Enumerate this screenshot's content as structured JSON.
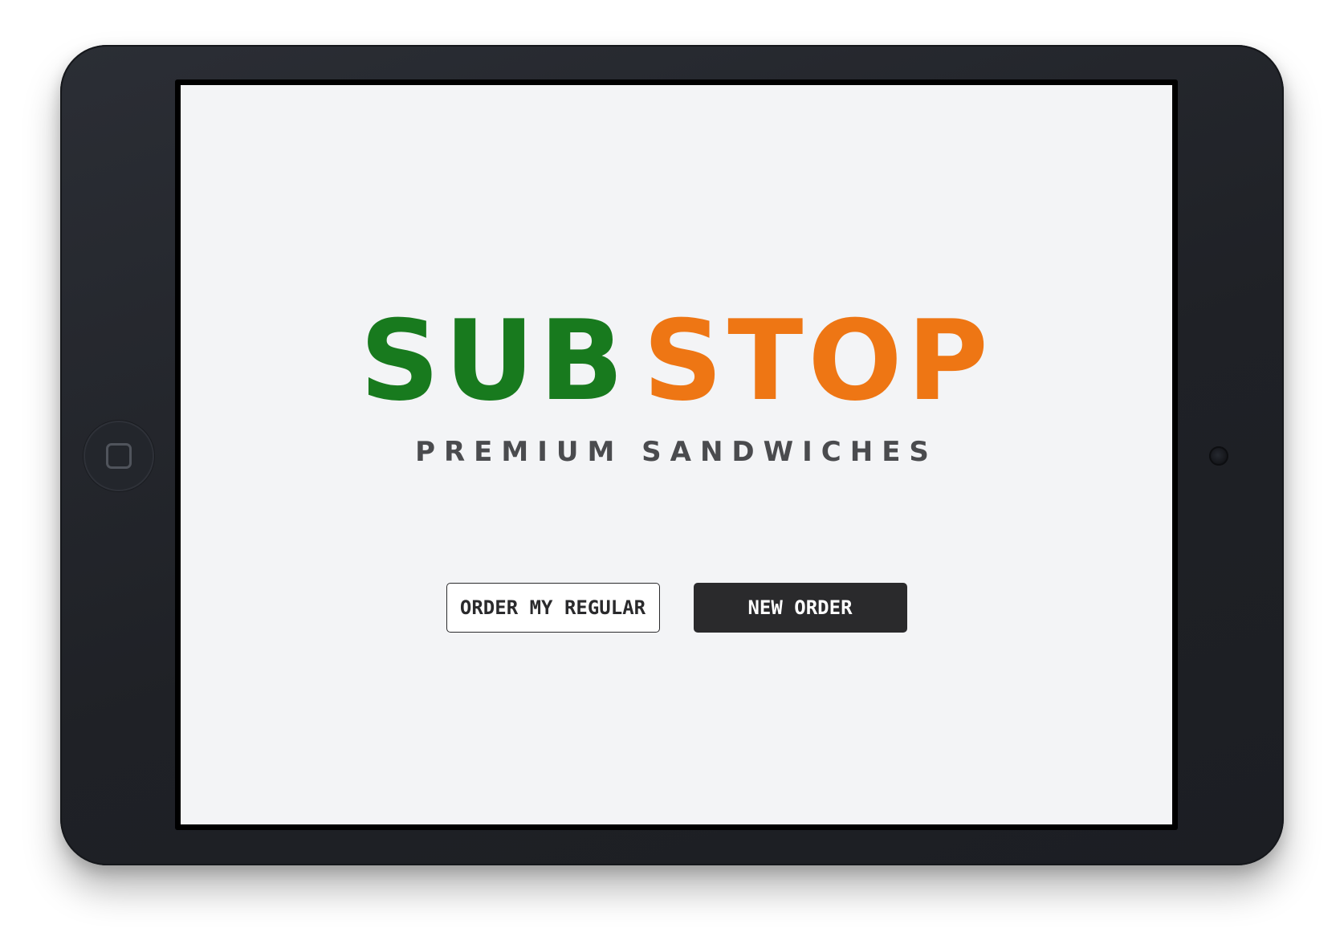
{
  "brand": {
    "name_part1": "SUB",
    "name_part2": "STOP",
    "tagline": "PREMIUM SANDWICHES",
    "color_part1": "#187a1e",
    "color_part2": "#ee7614"
  },
  "actions": {
    "order_regular_label": "ORDER MY REGULAR",
    "new_order_label": "NEW ORDER"
  },
  "device": {
    "home_button_icon": "home-square-icon",
    "camera_icon": "camera-lens-icon"
  }
}
